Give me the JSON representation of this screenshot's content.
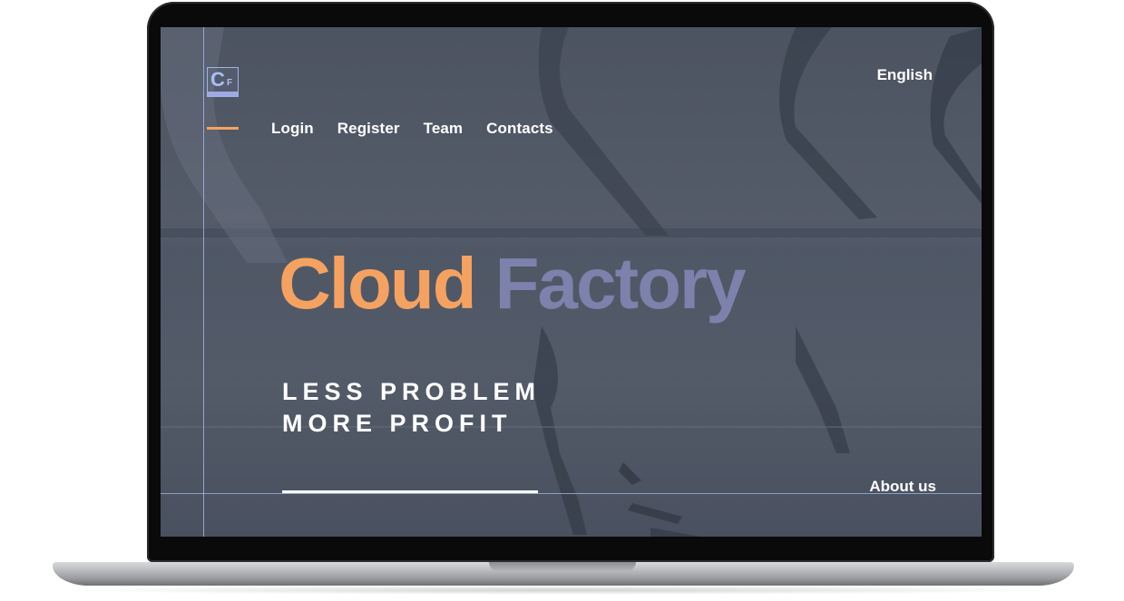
{
  "site": {
    "logo": {
      "main_letter": "C",
      "sub_letter": "F"
    },
    "nav": [
      {
        "label": "Login"
      },
      {
        "label": "Register"
      },
      {
        "label": "Team"
      },
      {
        "label": "Contacts"
      }
    ],
    "language": "English",
    "hero": {
      "title_word_1": "Cloud",
      "title_word_2": "Factory",
      "tagline_line_1": "LESS PROBLEM",
      "tagline_line_2": "MORE PROFIT"
    },
    "about_link": "About us"
  },
  "colors": {
    "accent_orange": "#f5a261",
    "accent_slate": "#7c82ab",
    "guide_blue": "#9fb4e6",
    "background": "#4f5664"
  }
}
